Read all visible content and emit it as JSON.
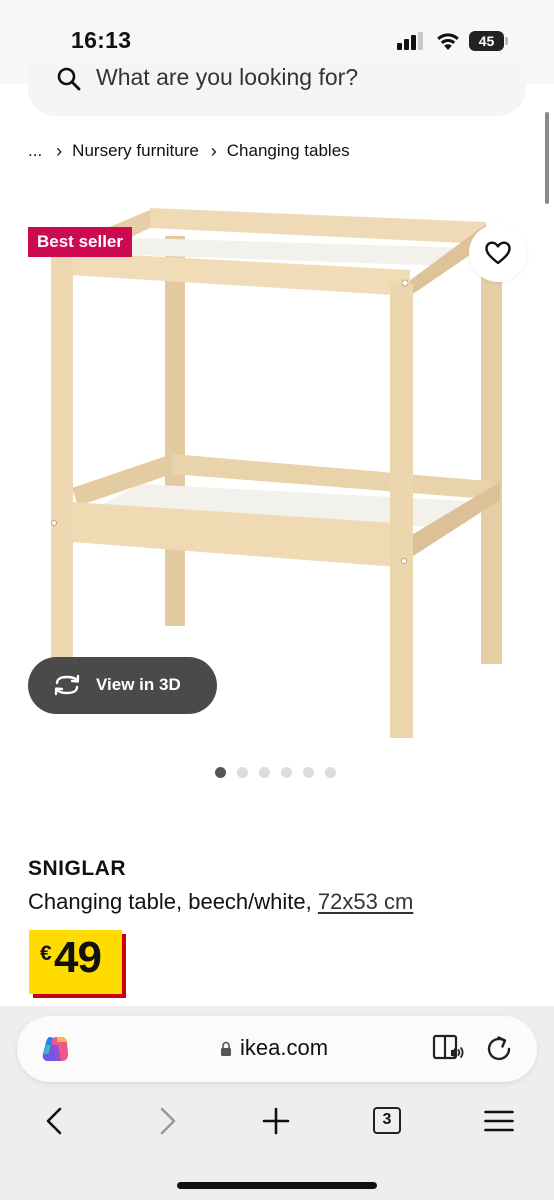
{
  "status_bar": {
    "time": "16:13",
    "battery": "45"
  },
  "search": {
    "placeholder": "What are you looking for?"
  },
  "breadcrumb": {
    "ellipsis": "...",
    "items": [
      "Nursery furniture",
      "Changing tables"
    ]
  },
  "product": {
    "badge": "Best seller",
    "view_3d_label": "View in 3D",
    "image_count": 6,
    "active_image_index": 0,
    "name": "SNIGLAR",
    "description": "Changing table, beech/white,",
    "size": "72x53 cm",
    "price": {
      "currency": "€",
      "value": "49"
    }
  },
  "browser": {
    "url": "ikea.com",
    "tab_count": "3",
    "icons": [
      "copilot-icon",
      "lock-icon",
      "reader-icon",
      "reload-icon",
      "back-icon",
      "forward-icon",
      "new-tab-icon",
      "menu-icon"
    ]
  },
  "colors": {
    "badge": "#cc0a4f",
    "price_yellow": "#ffdb00",
    "price_shadow": "#cc0008",
    "view3d_bg": "#4a4a4a",
    "wood": "#ecd7b2"
  }
}
